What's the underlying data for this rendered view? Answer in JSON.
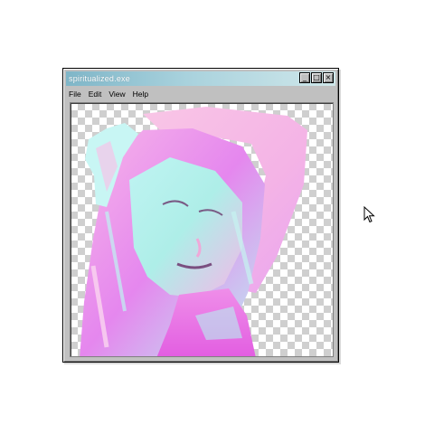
{
  "window": {
    "title": "spiritualized.exe",
    "controls": {
      "minimize": "_",
      "maximize": "□",
      "close": "×"
    }
  },
  "menu": [
    {
      "label": "File"
    },
    {
      "label": "Edit"
    },
    {
      "label": "View"
    },
    {
      "label": "Help"
    }
  ],
  "colors": {
    "titlebar_start": "#7fb6c8",
    "titlebar_end": "#cfe7ea",
    "window_bg": "#c0c0c0",
    "accent_pink": "#e85be0",
    "accent_cyan": "#a9f0f0"
  },
  "icons": {
    "cursor": "arrow-cursor-icon"
  }
}
